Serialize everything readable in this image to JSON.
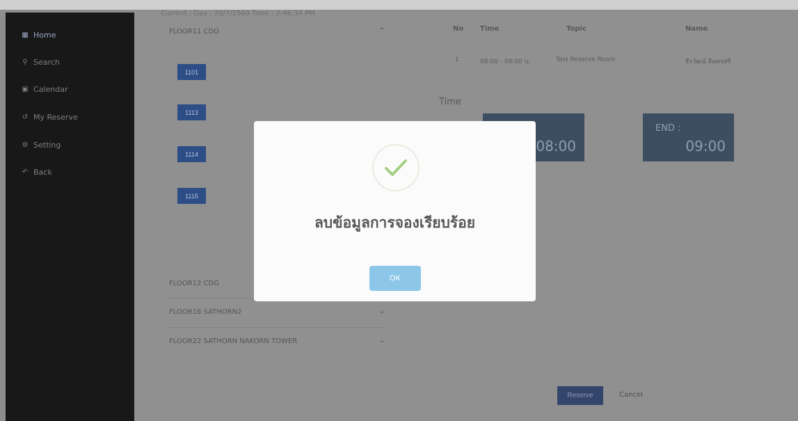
{
  "sidebar": {
    "items": [
      {
        "icon": "grid-icon",
        "label": "Home",
        "active": true
      },
      {
        "icon": "search-icon",
        "label": "Search"
      },
      {
        "icon": "calendar-icon",
        "label": "Calendar"
      },
      {
        "icon": "history-icon",
        "label": "My Reserve"
      },
      {
        "icon": "gear-icon",
        "label": "Setting"
      },
      {
        "icon": "back-icon",
        "label": "Back"
      }
    ]
  },
  "current_info": "Current : Day : 20/7/2560 Time : 2:46:34 PM",
  "floors": [
    {
      "name": "FLOOR11 CDG",
      "expanded": true,
      "rooms": [
        "1101",
        "1113",
        "1114",
        "1115"
      ]
    },
    {
      "name": "FLOOR12 CDG",
      "expanded": false
    },
    {
      "name": "FLOOR16 SATHORN2",
      "expanded": false
    },
    {
      "name": "FLOOR22 SATHORN NAKORN TOWER",
      "expanded": false
    }
  ],
  "reservations": {
    "headers": {
      "no": "No",
      "time": "Time",
      "topic": "Topic",
      "name": "Name"
    },
    "rows": [
      {
        "no": "1",
        "time": "08:00 - 09:00 น.",
        "topic": "Test Reserve Room",
        "name": "ธีรวัฒน์ สินทรศรี"
      }
    ]
  },
  "time_section": {
    "label": "Time",
    "start": {
      "label": "",
      "value": "08:00"
    },
    "end": {
      "label": "END :",
      "value": "09:00"
    }
  },
  "actions": {
    "reserve": "Reserve",
    "cancel": "Cancel"
  },
  "modal": {
    "title": "ลบข้อมูลการจองเรียบร้อย",
    "ok": "OK"
  },
  "colors": {
    "sidebar_bg": "#181818",
    "room_button": "#2d4d86",
    "time_box": "#3e4e61",
    "ok_button": "#8cc6e9",
    "check": "#a5cf85"
  }
}
